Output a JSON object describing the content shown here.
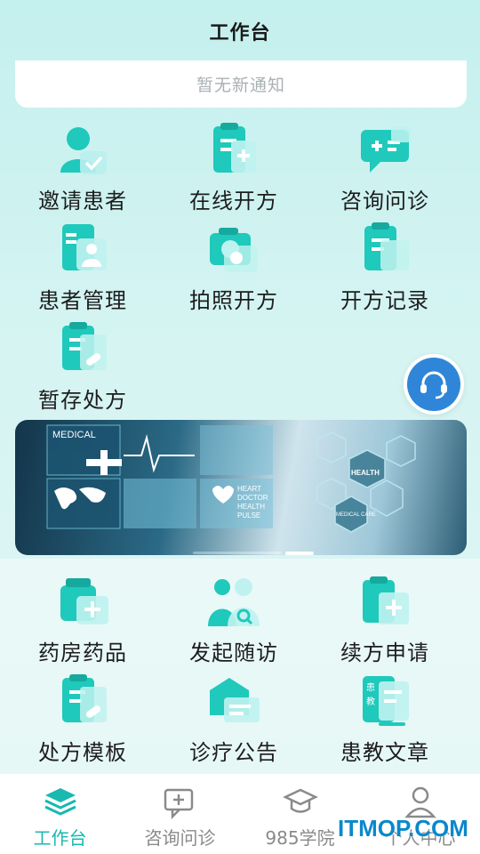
{
  "header": {
    "title": "工作台"
  },
  "notice": {
    "text": "暂无新通知"
  },
  "grid_top": [
    {
      "label": "邀请患者",
      "icon": "invite-patient-icon"
    },
    {
      "label": "在线开方",
      "icon": "online-prescription-icon"
    },
    {
      "label": "咨询问诊",
      "icon": "consultation-icon"
    },
    {
      "label": "患者管理",
      "icon": "patient-management-icon"
    },
    {
      "label": "拍照开方",
      "icon": "photo-prescription-icon"
    },
    {
      "label": "开方记录",
      "icon": "prescription-record-icon"
    },
    {
      "label": "暂存处方",
      "icon": "draft-prescription-icon"
    }
  ],
  "banner": {
    "texts": [
      "MEDICAL",
      "HEALTH",
      "MEDICAL CARE",
      "HEART",
      "DOCTOR",
      "HEALTH",
      "PULSE"
    ],
    "active_index": 1,
    "count": 3
  },
  "grid_bottom": [
    {
      "label": "药房药品",
      "icon": "pharmacy-icon"
    },
    {
      "label": "发起随访",
      "icon": "follow-up-icon"
    },
    {
      "label": "续方申请",
      "icon": "renewal-icon"
    },
    {
      "label": "处方模板",
      "icon": "template-icon"
    },
    {
      "label": "诊疗公告",
      "icon": "announcement-icon"
    },
    {
      "label": "患教文章",
      "icon": "article-icon"
    }
  ],
  "tabs": [
    {
      "label": "工作台",
      "icon": "layers-icon",
      "active": true
    },
    {
      "label": "咨询问诊",
      "icon": "chat-plus-icon",
      "active": false
    },
    {
      "label": "985学院",
      "icon": "graduation-cap-icon",
      "active": false
    },
    {
      "label": "个人中心",
      "icon": "user-icon",
      "active": false
    }
  ],
  "watermark": "ITMOP.COM",
  "colors": {
    "accent": "#19b8b0",
    "icon_main": "#1fc9bb",
    "icon_light": "#a9ecea",
    "support": "#2f86d8"
  }
}
